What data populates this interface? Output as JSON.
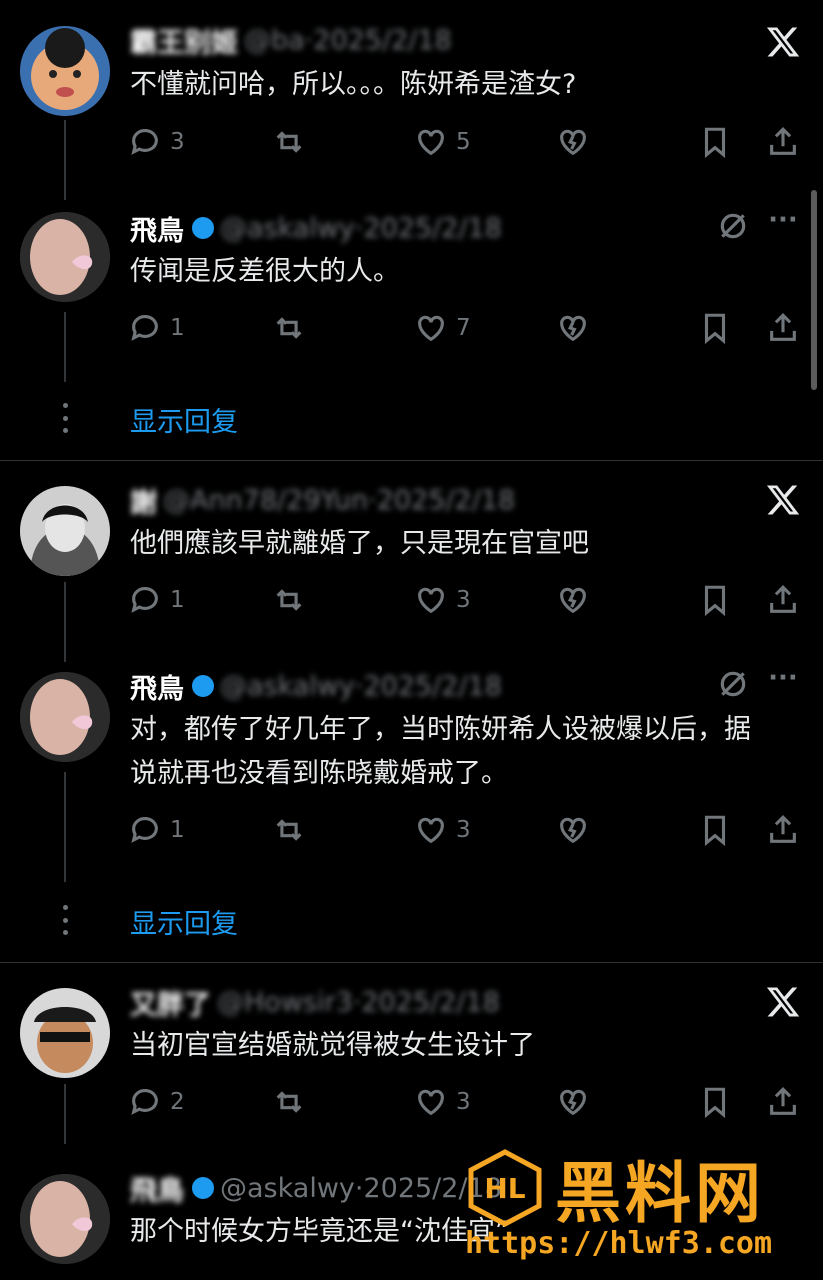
{
  "posts": [
    {
      "name": "霸王别姬",
      "meta": "@ba·2025/2/18",
      "text": "不懂就问哈，所以。。。陈妍希是渣女?",
      "reply_count": "3",
      "like_count": "5",
      "corner": "x"
    },
    {
      "name": "飛鳥",
      "meta": "@askalwy·2025/2/18",
      "text": "传闻是反差很大的人。",
      "reply_count": "1",
      "like_count": "7",
      "corner": "mute"
    },
    {
      "name": "謝",
      "meta": "@Ann78/29Yun·2025/2/18",
      "text": "他們應該早就離婚了，只是現在官宣吧",
      "reply_count": "1",
      "like_count": "3",
      "corner": "x"
    },
    {
      "name": "飛鳥",
      "meta": "@askalwy·2025/2/18",
      "text": "对，都传了好几年了，当时陈妍希人设被爆以后，据说就再也没看到陈晓戴婚戒了。",
      "reply_count": "1",
      "like_count": "3",
      "corner": "mute"
    },
    {
      "name": "又胖了",
      "meta": "@Howsir3·2025/2/18",
      "text": "当初官宣结婚就觉得被女生设计了",
      "reply_count": "2",
      "like_count": "3",
      "corner": "x"
    },
    {
      "name": "飛鳥",
      "meta": "@askalwy·2025/2/18",
      "text": "那个时候女方毕竟还是“沈佳宜”",
      "reply_count": "",
      "like_count": "",
      "corner": "mute"
    }
  ],
  "show_replies_label": "显示回复",
  "watermark": {
    "logo_text": "HL",
    "brand": "黑料网",
    "url": "https://hlwf3.com"
  },
  "colors": {
    "background": "#000000",
    "text": "#e7e9ea",
    "muted": "#71767b",
    "link": "#1d9bf0",
    "watermark": "#f5a623"
  },
  "icons": [
    "reply-icon",
    "repost-icon",
    "like-icon",
    "broken-heart-icon",
    "bookmark-icon",
    "share-icon",
    "x-logo-icon",
    "mute-icon",
    "more-icon"
  ]
}
